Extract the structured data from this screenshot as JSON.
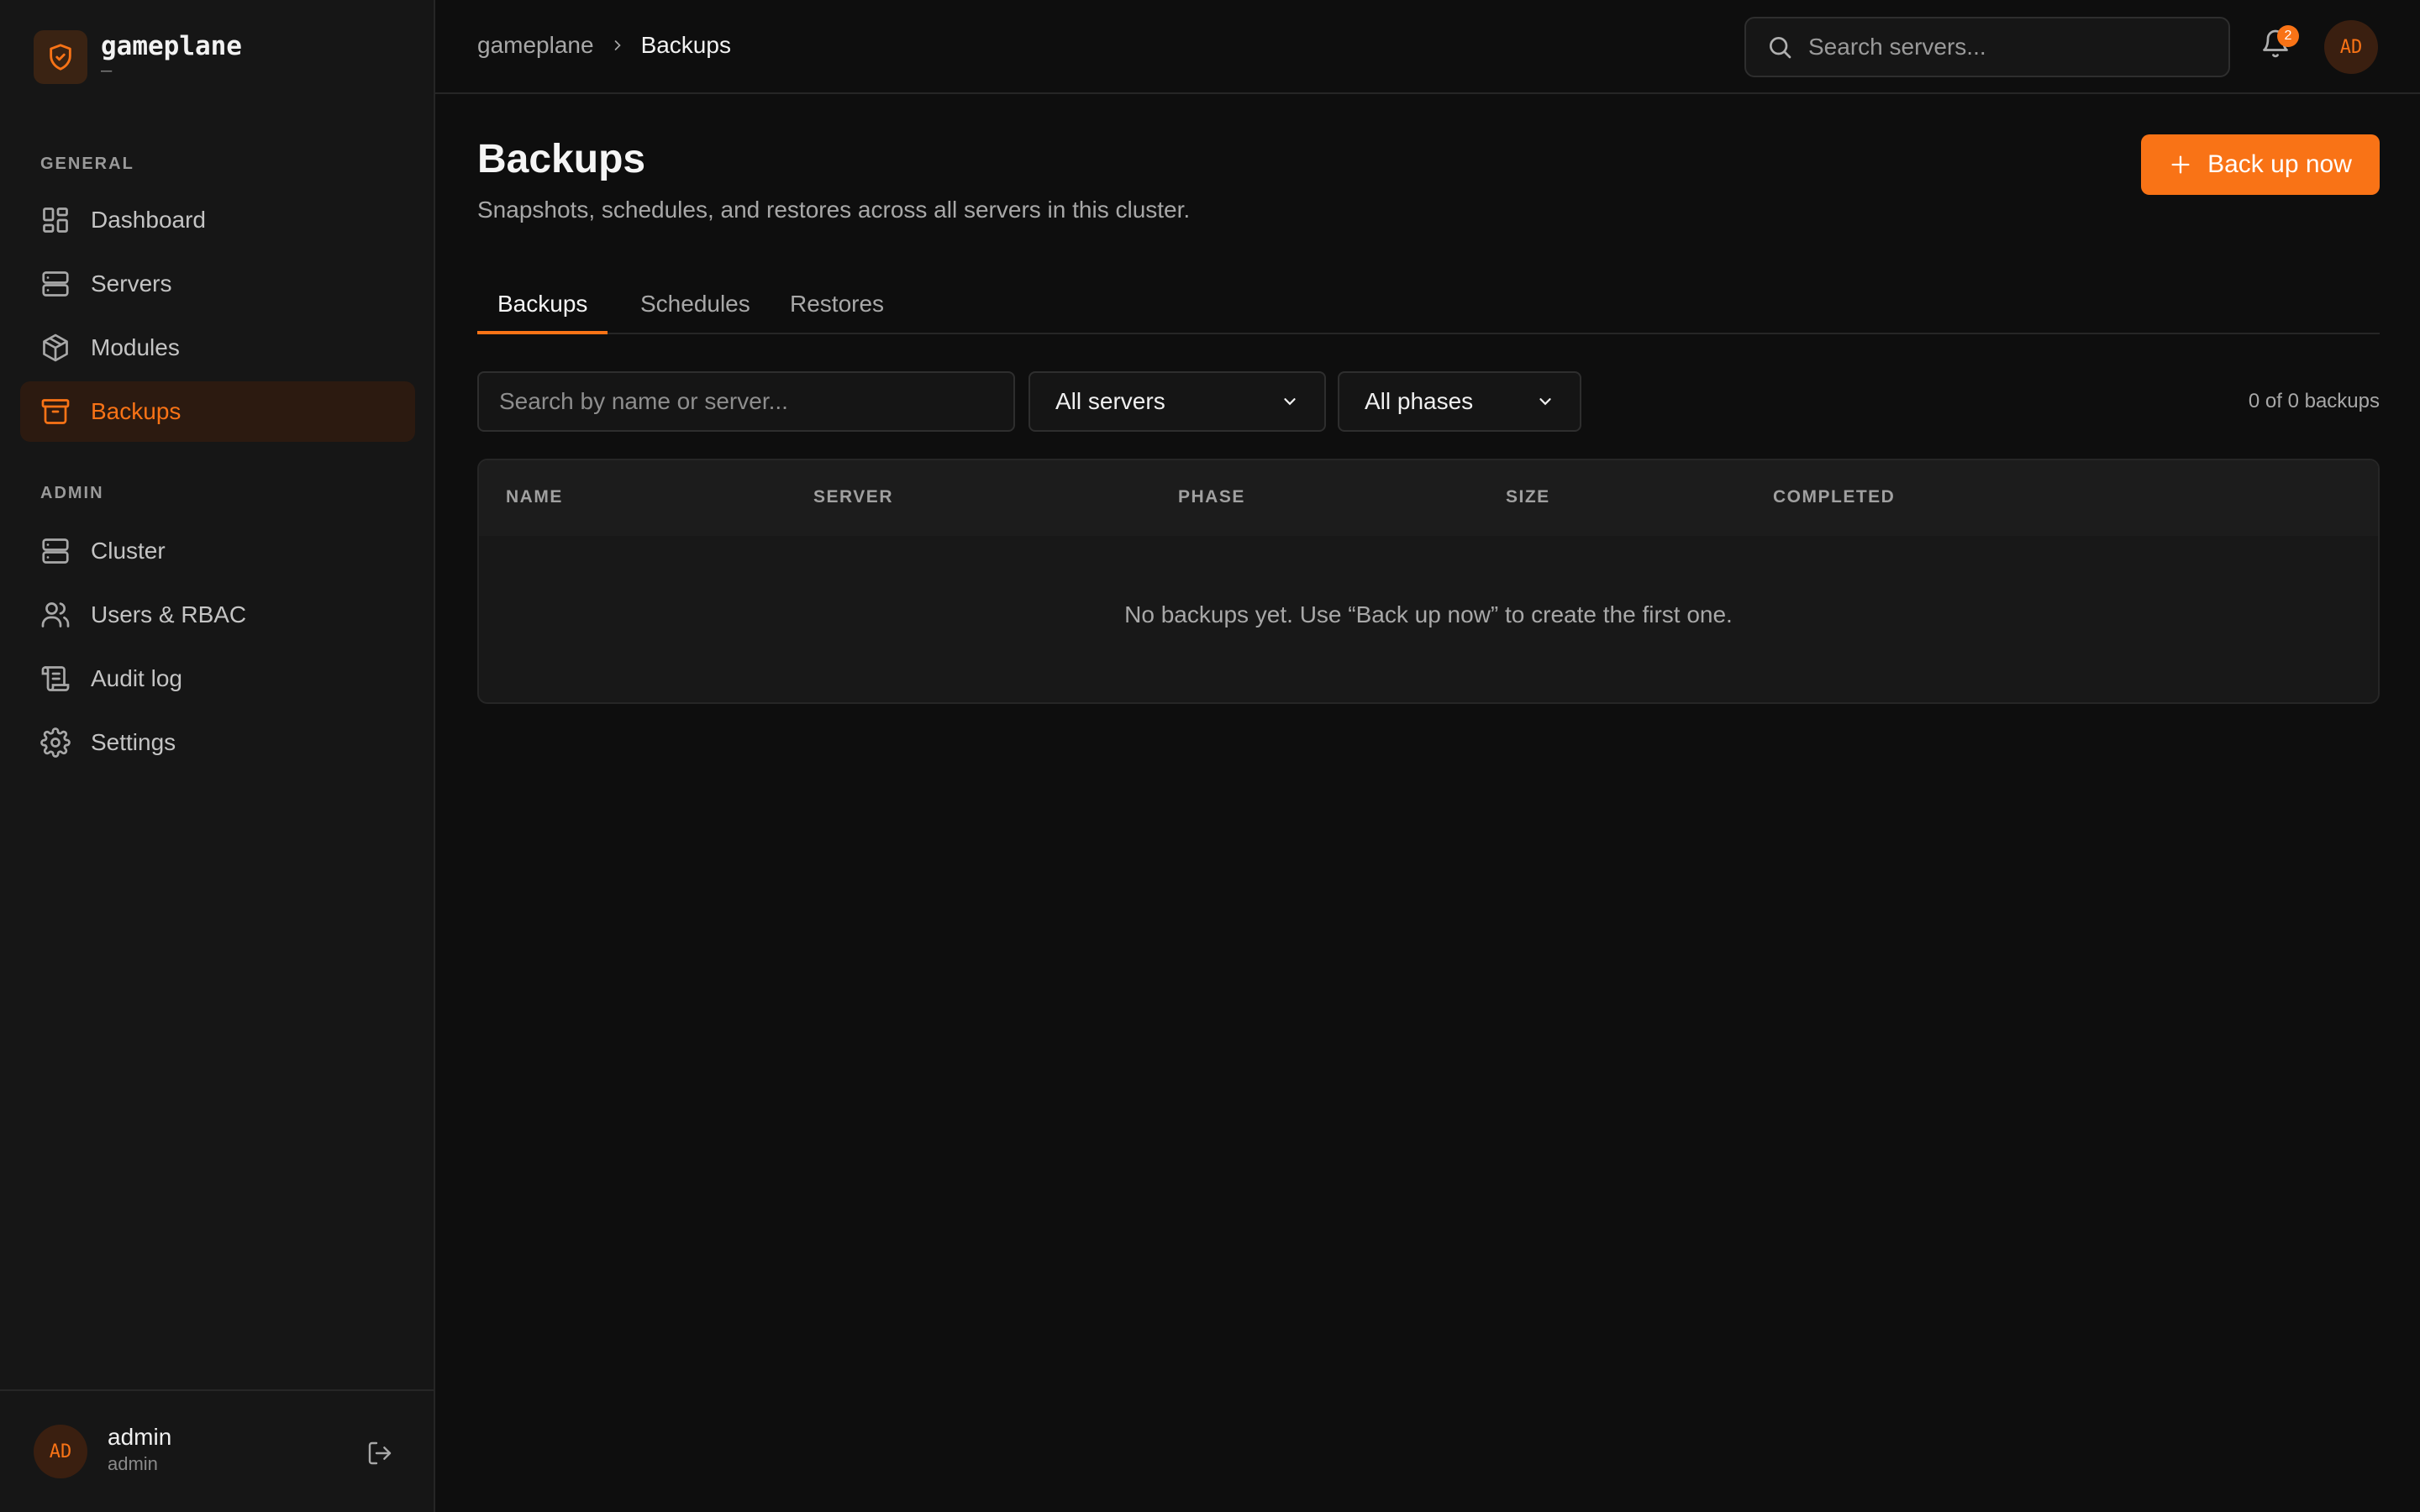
{
  "brand": {
    "name": "gameplane",
    "subtitle": "—"
  },
  "sidebar": {
    "general_label": "GENERAL",
    "general_items": [
      {
        "label": "Dashboard",
        "icon": "dashboard-icon"
      },
      {
        "label": "Servers",
        "icon": "server-icon"
      },
      {
        "label": "Modules",
        "icon": "package-icon"
      },
      {
        "label": "Backups",
        "icon": "archive-icon",
        "active": true
      }
    ],
    "admin_label": "ADMIN",
    "admin_items": [
      {
        "label": "Cluster",
        "icon": "server-icon"
      },
      {
        "label": "Users & RBAC",
        "icon": "users-icon"
      },
      {
        "label": "Audit log",
        "icon": "scroll-icon"
      },
      {
        "label": "Settings",
        "icon": "gear-icon"
      }
    ],
    "user": {
      "initials": "AD",
      "name": "admin",
      "role": "admin"
    }
  },
  "topbar": {
    "breadcrumb": {
      "root": "gameplane",
      "current": "Backups"
    },
    "search_placeholder": "Search servers...",
    "notification_count": "2",
    "avatar_initials": "AD"
  },
  "page": {
    "title": "Backups",
    "subtitle": "Snapshots, schedules, and restores across all servers in this cluster.",
    "primary_action": "Back up now"
  },
  "tabs": [
    {
      "label": "Backups",
      "active": true
    },
    {
      "label": "Schedules"
    },
    {
      "label": "Restores"
    }
  ],
  "filters": {
    "search_placeholder": "Search by name or server...",
    "server_select": "All servers",
    "phase_select": "All phases",
    "count_text": "0 of 0 backups"
  },
  "table": {
    "columns": [
      "NAME",
      "SERVER",
      "PHASE",
      "SIZE",
      "COMPLETED"
    ],
    "empty_message": "No backups yet. Use “Back up now” to create the first one."
  },
  "colors": {
    "accent": "#f97316",
    "background": "#0e0e0e",
    "sidebar": "#161616",
    "active_nav_bg": "#2c1a10"
  }
}
